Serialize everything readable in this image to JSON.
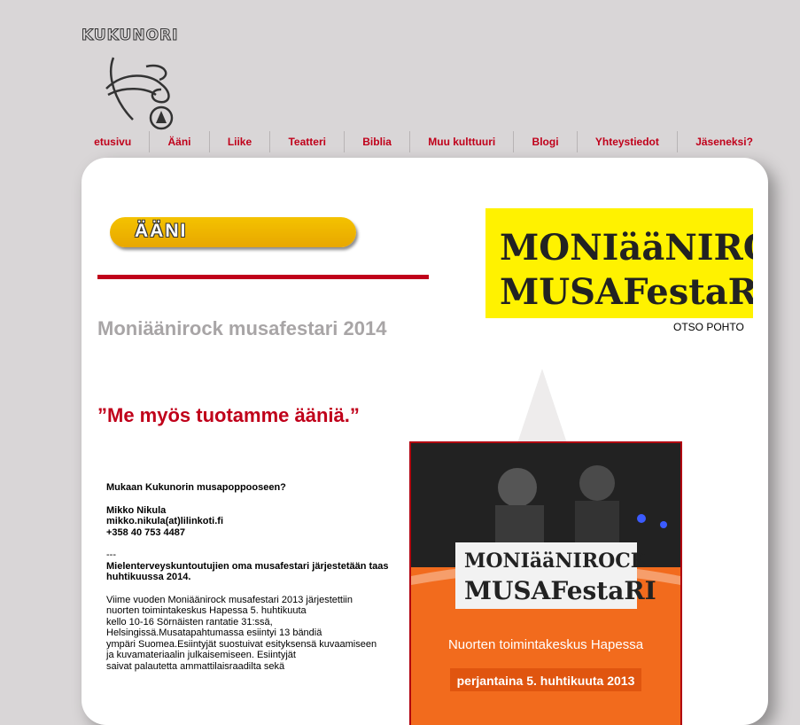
{
  "logo": {
    "text": "KUKUNORI"
  },
  "nav": {
    "items": [
      {
        "label": "etusivu"
      },
      {
        "label": "Ääni"
      },
      {
        "label": "Liike"
      },
      {
        "label": "Teatteri"
      },
      {
        "label": "Biblia"
      },
      {
        "label": "Muu kulttuuri"
      },
      {
        "label": "Blogi"
      },
      {
        "label": "Yhteystiedot"
      },
      {
        "label": "Jäseneksi?"
      }
    ]
  },
  "section_badge": "ÄÄNI",
  "page_title": "Moniäänirock musafestari 2014",
  "tagline": "”Me myös tuotamme ääniä.”",
  "festari_logo": {
    "line1": "MONIääNIROCK",
    "line2": "MUSAFestaRI",
    "credit": "OTSO POHTO"
  },
  "content": {
    "heading": "Mukaan Kukunorin musapoppooseen?",
    "contact_name": "Mikko Nikula",
    "contact_email": "mikko.nikula(at)lilinkoti.fi",
    "contact_phone": "+358 40 753 4487",
    "separator": "---",
    "announce": "Mielenterveyskuntoutujien oma musafestari järjestetään taas huhtikuussa 2014.",
    "body_lines": [
      "Viime vuoden Moniäänirock musafestari 2013 järjestettiin",
      "nuorten toimintakeskus Hapessa 5. huhtikuuta",
      "kello 10-16 Sörnäisten rantatie 31:ssä,",
      "Helsingissä.Musatapahtumassa esiintyi 13 bändiä",
      "ympäri Suomea.Esiintyjät suostuivat esityksensä kuvaamiseen",
      "ja kuvamateriaalin julkaisemiseen. Esiintyjät",
      "saivat palautetta ammattilaisraadilta sekä"
    ]
  },
  "poster": {
    "title1": "MONIääNIROCK",
    "title2": "MUSAFestaRI",
    "venue": "Nuorten toimintakeskus Hapessa",
    "date": "perjantaina 5. huhtikuuta 2013"
  },
  "colors": {
    "accent": "#c0001a",
    "badge": "#f0b400",
    "logo_bg": "#fff200",
    "poster_orange": "#f26b1d"
  }
}
